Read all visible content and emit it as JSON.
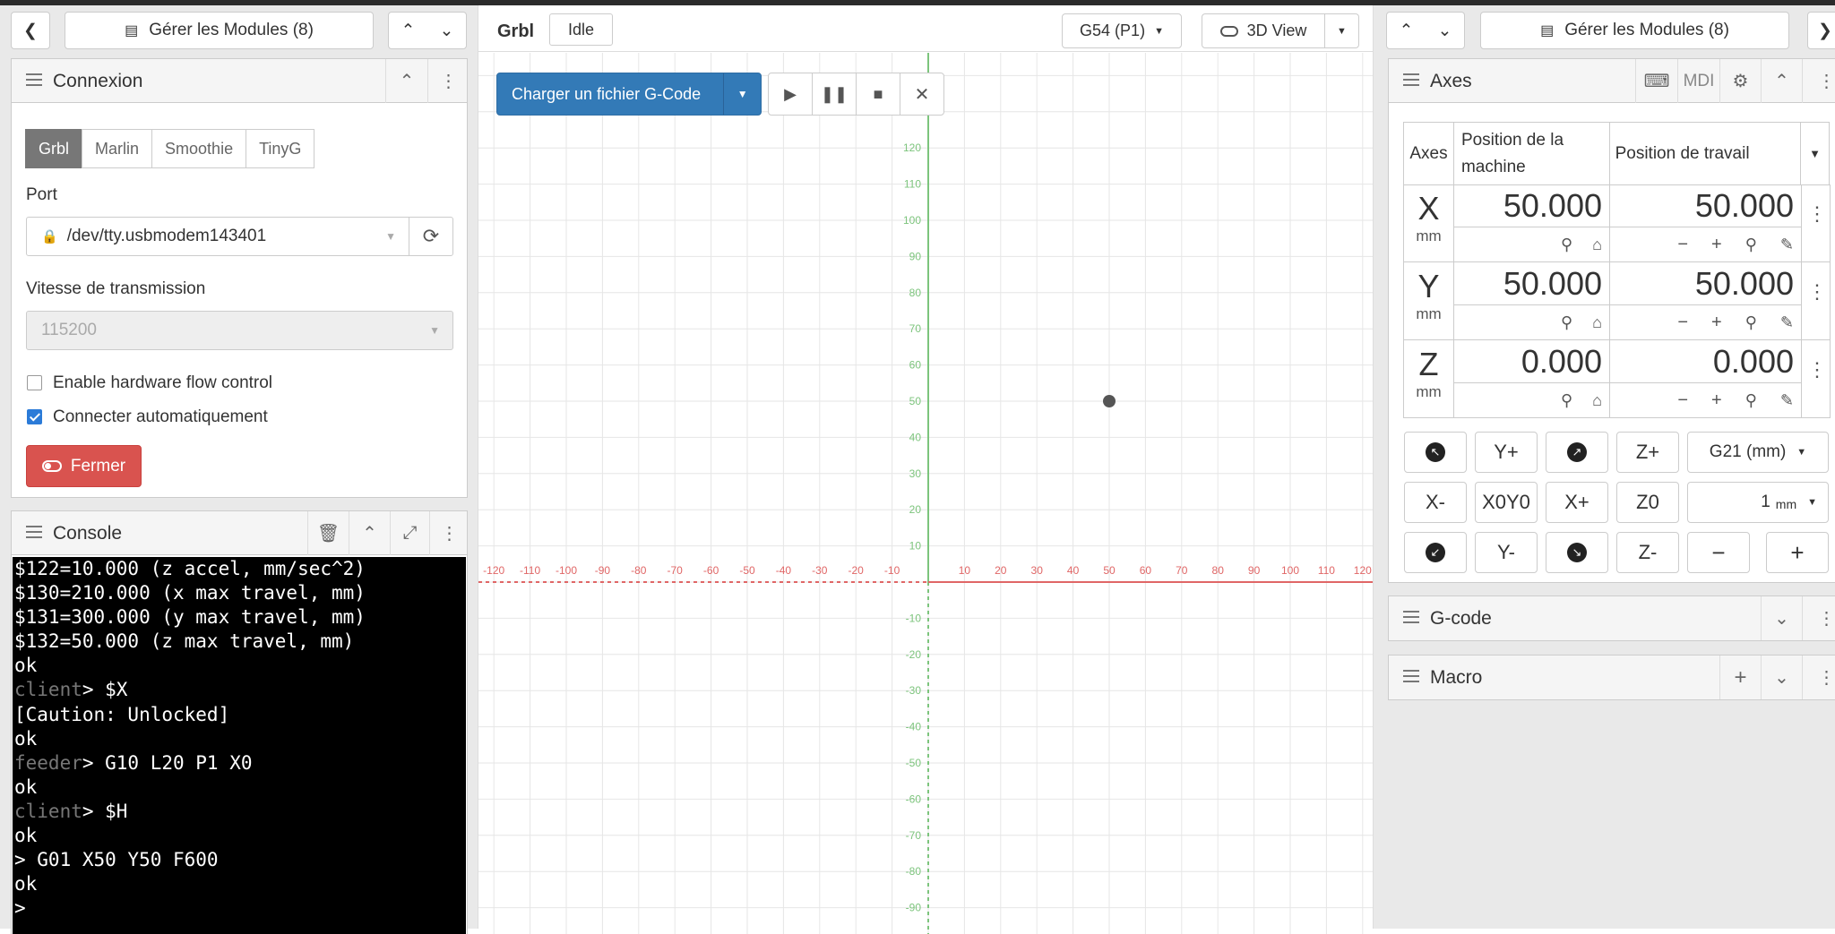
{
  "left": {
    "manage_modules": "Gérer les Modules (8)",
    "connection": {
      "title": "Connexion",
      "tabs": [
        {
          "label": "Grbl",
          "active": true
        },
        {
          "label": "Marlin"
        },
        {
          "label": "Smoothie"
        },
        {
          "label": "TinyG"
        }
      ],
      "port_label": "Port",
      "port_value": "/dev/tty.usbmodem143401",
      "baud_label": "Vitesse de transmission",
      "baud_value": "115200",
      "flow_control_label": "Enable hardware flow control",
      "flow_control_checked": false,
      "auto_connect_label": "Connecter automatiquement",
      "auto_connect_checked": true,
      "close_button": "Fermer"
    },
    "console": {
      "title": "Console",
      "lines": [
        {
          "prefix": "",
          "text": "$122=10.000 (z accel, mm/sec^2)"
        },
        {
          "prefix": "",
          "text": "$130=210.000 (x max travel, mm)"
        },
        {
          "prefix": "",
          "text": "$131=300.000 (y max travel, mm)"
        },
        {
          "prefix": "",
          "text": "$132=50.000 (z max travel, mm)"
        },
        {
          "prefix": "",
          "text": "ok"
        },
        {
          "prefix": "client",
          "text": "> $X"
        },
        {
          "prefix": "",
          "text": "[Caution: Unlocked]"
        },
        {
          "prefix": "",
          "text": "ok"
        },
        {
          "prefix": "feeder",
          "text": "> G10 L20 P1 X0"
        },
        {
          "prefix": "",
          "text": "ok"
        },
        {
          "prefix": "client",
          "text": "> $H"
        },
        {
          "prefix": "",
          "text": "ok"
        },
        {
          "prefix": "",
          "text": "> G01 X50 Y50 F600"
        },
        {
          "prefix": "",
          "text": "ok"
        },
        {
          "prefix": "",
          "text": ">"
        }
      ]
    }
  },
  "center": {
    "controller": "Grbl",
    "state": "Idle",
    "wcs": "G54 (P1)",
    "view": "3D View",
    "load_gcode": "Charger un fichier G-Code",
    "x_ticks": [
      -120,
      -110,
      -100,
      -90,
      -80,
      -70,
      -60,
      -50,
      -40,
      -30,
      -20,
      -10,
      10,
      20,
      30,
      40,
      50,
      60,
      70,
      80,
      90,
      100,
      110,
      120
    ],
    "y_ticks": [
      120,
      110,
      100,
      90,
      80,
      70,
      60,
      50,
      40,
      30,
      20,
      10,
      -10,
      -20,
      -30,
      -40,
      -50,
      -60,
      -70,
      -80,
      -90
    ],
    "tool_position": {
      "x": 50,
      "y": 50
    }
  },
  "right": {
    "manage_modules": "Gérer les Modules (8)",
    "axes": {
      "title": "Axes",
      "mdi": "MDI",
      "col_axes": "Axes",
      "col_machine": "Position de la machine",
      "col_work": "Position de travail",
      "rows": [
        {
          "axis": "X",
          "unit": "mm",
          "machine": "50.000",
          "work": "50.000"
        },
        {
          "axis": "Y",
          "unit": "mm",
          "machine": "50.000",
          "work": "50.000"
        },
        {
          "axis": "Z",
          "unit": "mm",
          "machine": "0.000",
          "work": "0.000"
        }
      ],
      "jog": {
        "y_plus": "Y+",
        "z_plus": "Z+",
        "units": "G21 (mm)",
        "x_minus": "X-",
        "x0y0": "X0Y0",
        "x_plus": "X+",
        "z0": "Z0",
        "step": "1",
        "step_unit": "mm",
        "y_minus": "Y-",
        "z_minus": "Z-"
      }
    },
    "gcode_title": "G-code",
    "macro_title": "Macro"
  }
}
